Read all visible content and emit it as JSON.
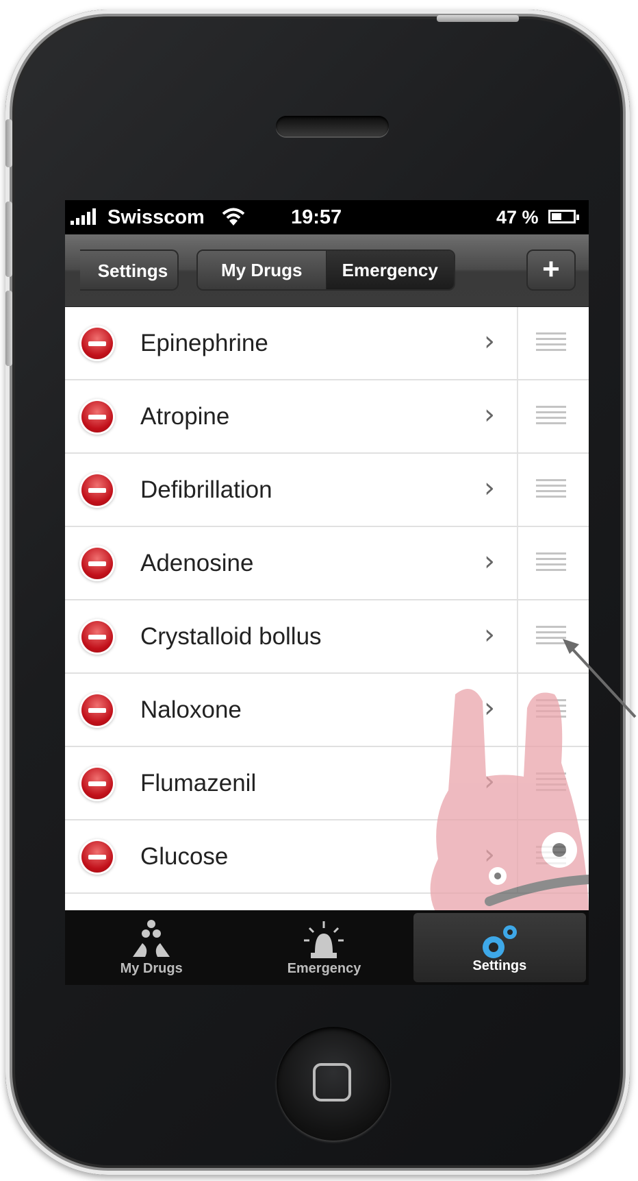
{
  "status_bar": {
    "carrier": "Swisscom",
    "time": "19:57",
    "battery_percent": "47 %",
    "battery_level": 0.47
  },
  "nav_bar": {
    "back_label": "Settings",
    "segments": [
      "My Drugs",
      "Emergency"
    ],
    "active_segment": "Emergency",
    "add_label": "+"
  },
  "list": {
    "items": [
      {
        "label": "Epinephrine"
      },
      {
        "label": "Atropine"
      },
      {
        "label": "Defibrillation"
      },
      {
        "label": "Adenosine"
      },
      {
        "label": "Crystalloid bollus"
      },
      {
        "label": "Naloxone"
      },
      {
        "label": "Flumazenil"
      },
      {
        "label": "Glucose"
      }
    ]
  },
  "tab_bar": {
    "tabs": [
      {
        "label": "My Drugs",
        "icon": "pills-icon"
      },
      {
        "label": "Emergency",
        "icon": "siren-icon"
      },
      {
        "label": "Settings",
        "icon": "gears-icon"
      }
    ],
    "active_tab": "Settings"
  },
  "colors": {
    "delete_red": "#c1101a",
    "tab_active_icon": "#3ea8e8",
    "mascot_pink": "#e9a4ab"
  }
}
